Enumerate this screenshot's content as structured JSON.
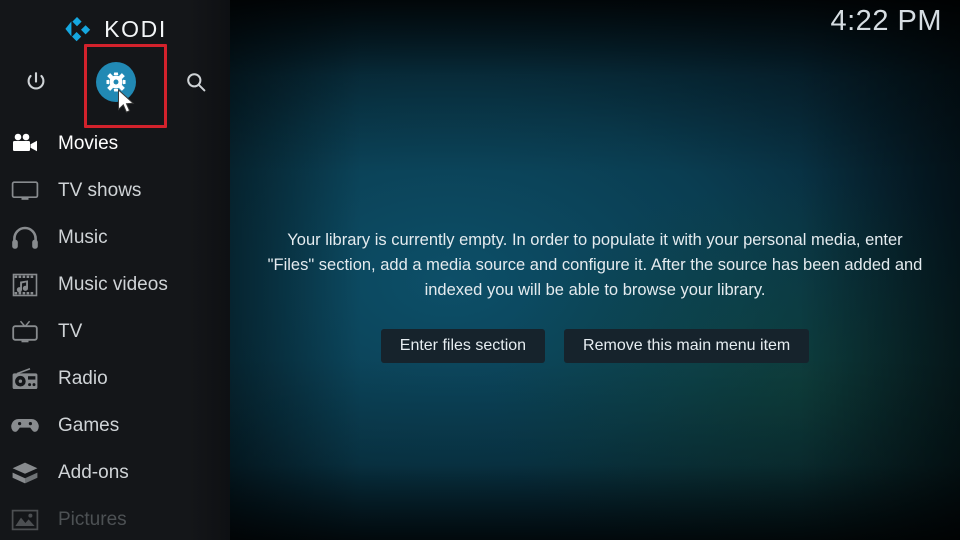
{
  "app": {
    "name": "KODI",
    "logo_icon": "kodi-logo-icon",
    "logo_color": "#15a7e0"
  },
  "clock": {
    "time": "4:22 PM"
  },
  "top_bar": {
    "power": {
      "label": "Power",
      "icon": "power-icon"
    },
    "settings": {
      "label": "Settings",
      "icon": "gear-icon",
      "circle_color": "#2189b4",
      "highlighted": true
    },
    "search": {
      "label": "Search",
      "icon": "search-icon"
    }
  },
  "highlight": {
    "color": "#d3222c",
    "target": "settings"
  },
  "cursor": {
    "icon": "mouse-pointer-icon"
  },
  "sidebar": {
    "items": [
      {
        "label": "Movies",
        "icon": "movie-camera-icon",
        "state": "active"
      },
      {
        "label": "TV shows",
        "icon": "monitor-icon",
        "state": "normal"
      },
      {
        "label": "Music",
        "icon": "headphones-icon",
        "state": "normal"
      },
      {
        "label": "Music videos",
        "icon": "film-note-icon",
        "state": "normal"
      },
      {
        "label": "TV",
        "icon": "television-icon",
        "state": "normal"
      },
      {
        "label": "Radio",
        "icon": "radio-icon",
        "state": "normal"
      },
      {
        "label": "Games",
        "icon": "gamepad-icon",
        "state": "normal"
      },
      {
        "label": "Add-ons",
        "icon": "addon-box-icon",
        "state": "normal"
      },
      {
        "label": "Pictures",
        "icon": "picture-icon",
        "state": "dim"
      }
    ]
  },
  "main": {
    "empty_message": "Your library is currently empty. In order to populate it with your personal media, enter \"Files\" section, add a media source and configure it. After the source has been added and indexed you will be able to browse your library.",
    "buttons": [
      {
        "label": "Enter files section"
      },
      {
        "label": "Remove this main menu item"
      }
    ]
  },
  "colors": {
    "sidebar_bg": "#141619",
    "accent_blue": "#2189b4",
    "button_bg": "#16232c",
    "highlight_red": "#d3222c"
  }
}
